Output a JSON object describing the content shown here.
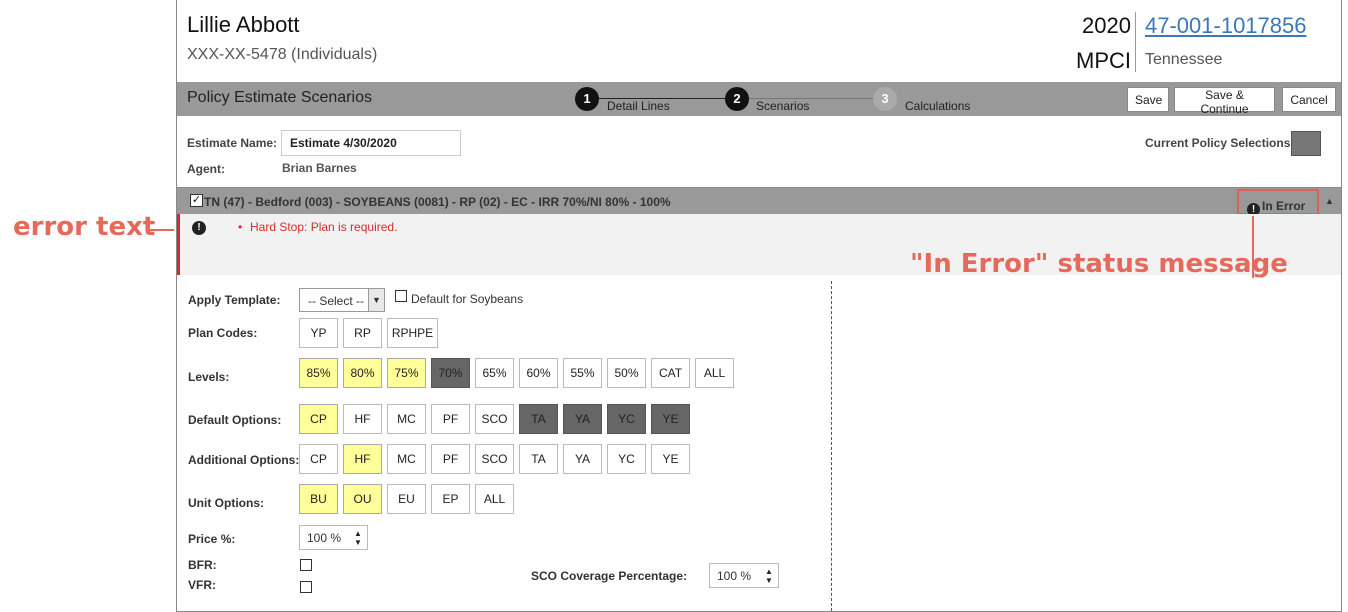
{
  "header": {
    "name": "Lillie Abbott",
    "ssn": "XXX-XX-5478 (Individuals)",
    "year": "2020",
    "type": "MPCI",
    "policy_number": "47-001-1017856",
    "state": "Tennessee"
  },
  "titlebar": {
    "title": "Policy Estimate Scenarios",
    "steps": [
      {
        "number": "1",
        "label": "Detail Lines",
        "active": true
      },
      {
        "number": "2",
        "label": "Scenarios",
        "active": true
      },
      {
        "number": "3",
        "label": "Calculations",
        "active": false
      }
    ],
    "buttons": {
      "save": "Save",
      "save_continue": "Save & Continue",
      "cancel": "Cancel"
    }
  },
  "estimate": {
    "name_label": "Estimate Name:",
    "name_value": "Estimate 4/30/2020",
    "agent_label": "Agent:",
    "agent_value": "Brian Barnes",
    "current_selections_label": "Current Policy Selections ="
  },
  "section": {
    "title": "TN (47) - Bedford (003) - SOYBEANS (0081) - RP (02) - EC - IRR 70%/NI 80% - 100%",
    "status": "In Error",
    "error_message": "Hard Stop: Plan is required."
  },
  "form": {
    "apply_template_label": "Apply Template:",
    "select_value": "-- Select --",
    "default_label": "Default for Soybeans",
    "plan_codes_label": "Plan Codes:",
    "plan_codes": [
      "YP",
      "RP",
      "RPHPE"
    ],
    "levels_label": "Levels:",
    "levels": [
      {
        "label": "85%",
        "state": "selected"
      },
      {
        "label": "80%",
        "state": "selected"
      },
      {
        "label": "75%",
        "state": "selected"
      },
      {
        "label": "70%",
        "state": "current"
      },
      {
        "label": "65%",
        "state": "none"
      },
      {
        "label": "60%",
        "state": "none"
      },
      {
        "label": "55%",
        "state": "none"
      },
      {
        "label": "50%",
        "state": "none"
      },
      {
        "label": "CAT",
        "state": "none"
      },
      {
        "label": "ALL",
        "state": "none"
      }
    ],
    "default_options_label": "Default Options:",
    "default_options": [
      {
        "label": "CP",
        "state": "selected"
      },
      {
        "label": "HF",
        "state": "none"
      },
      {
        "label": "MC",
        "state": "none"
      },
      {
        "label": "PF",
        "state": "none"
      },
      {
        "label": "SCO",
        "state": "none"
      },
      {
        "label": "TA",
        "state": "current"
      },
      {
        "label": "YA",
        "state": "current"
      },
      {
        "label": "YC",
        "state": "current"
      },
      {
        "label": "YE",
        "state": "current"
      }
    ],
    "additional_options_label": "Additional Options:",
    "additional_options": [
      {
        "label": "CP",
        "state": "none"
      },
      {
        "label": "HF",
        "state": "selected"
      },
      {
        "label": "MC",
        "state": "none"
      },
      {
        "label": "PF",
        "state": "none"
      },
      {
        "label": "SCO",
        "state": "none"
      },
      {
        "label": "TA",
        "state": "none"
      },
      {
        "label": "YA",
        "state": "none"
      },
      {
        "label": "YC",
        "state": "none"
      },
      {
        "label": "YE",
        "state": "none"
      }
    ],
    "unit_options_label": "Unit Options:",
    "unit_options": [
      {
        "label": "BU",
        "state": "selected"
      },
      {
        "label": "OU",
        "state": "selected"
      },
      {
        "label": "EU",
        "state": "none"
      },
      {
        "label": "EP",
        "state": "none"
      },
      {
        "label": "ALL",
        "state": "none"
      }
    ],
    "price_label": "Price %:",
    "price_value": "100 %",
    "bfr_label": "BFR:",
    "vfr_label": "VFR:",
    "sco_label": "SCO Coverage Percentage:",
    "sco_value": "100 %"
  },
  "annotations": {
    "error_text": "error text",
    "status_message": "\"In Error\" status message"
  },
  "colors": {
    "selected": "#ffff99",
    "current": "#666666",
    "error": "#d62b2b",
    "annotation": "#e56a5c",
    "link": "#3a78b8"
  }
}
